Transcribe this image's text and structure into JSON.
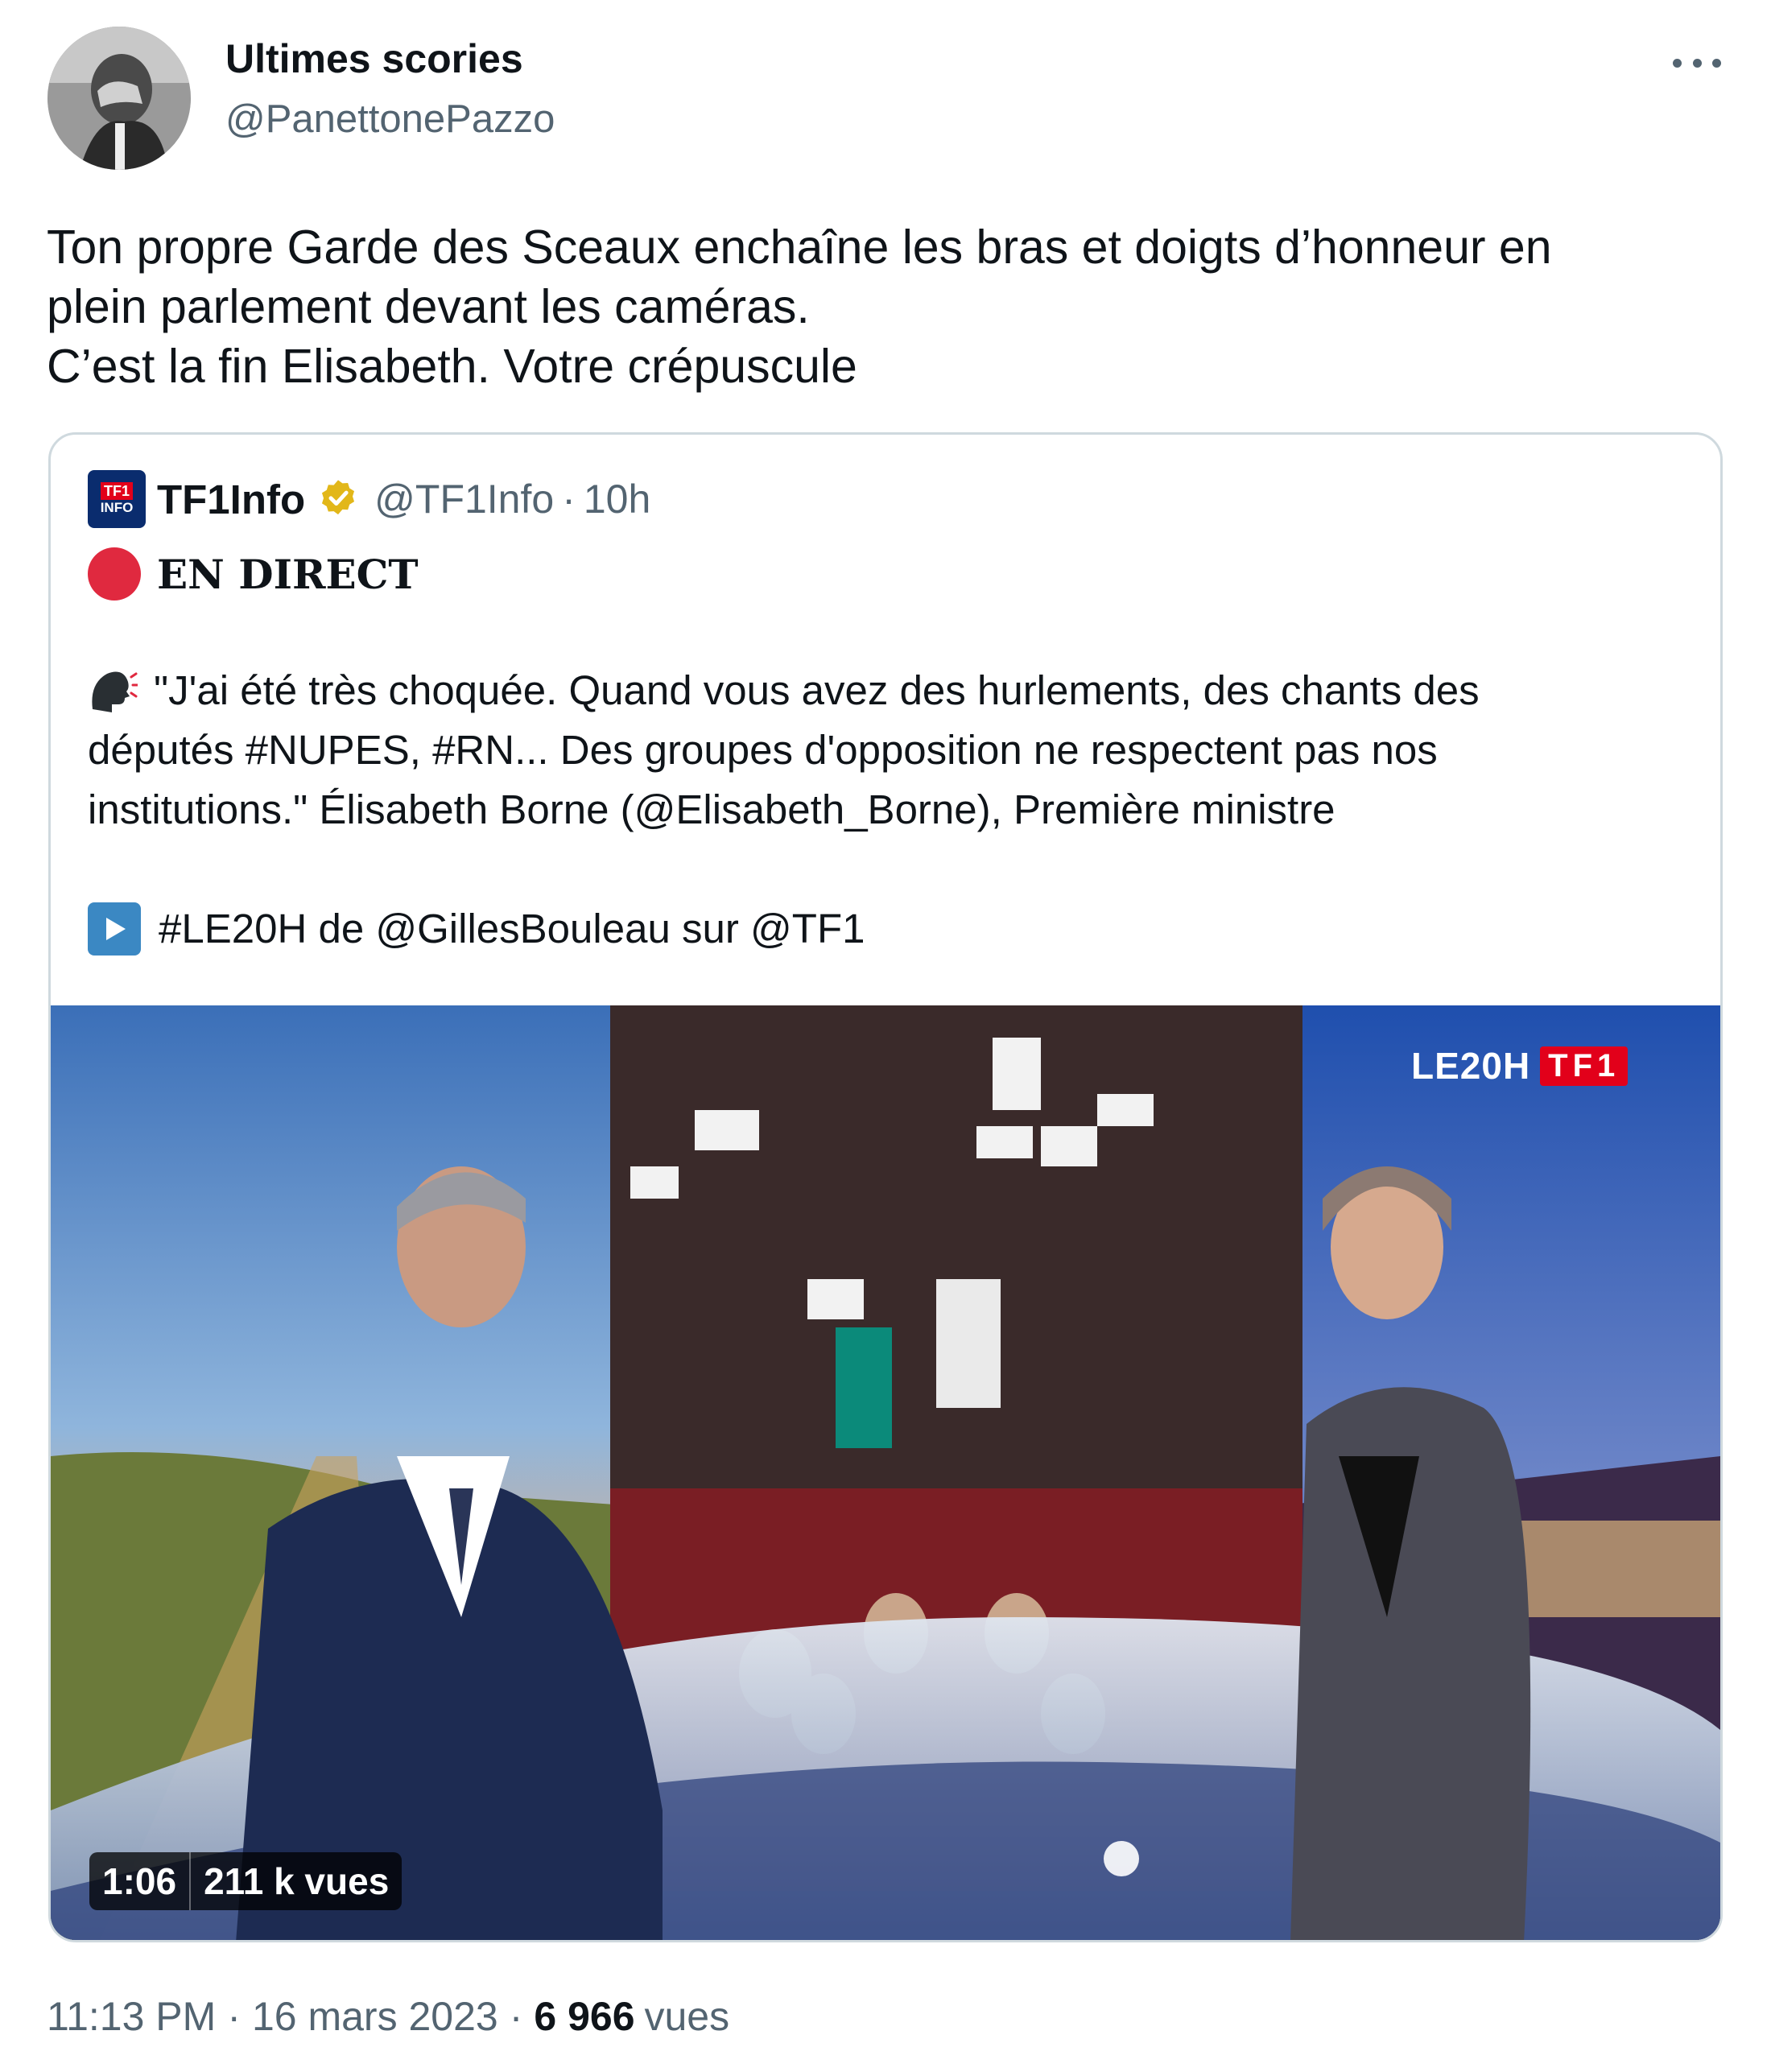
{
  "author": {
    "name": "Ultimes scories",
    "handle": "@PanettonePazzo",
    "avatar": "grayscale-man-facepalm-photo"
  },
  "more_icon": "more-horizontal-icon",
  "tweet_lines": [
    "Ton propre Garde des Sceaux enchaîne les bras et doigts d’honneur en",
    "plein parlement devant les caméras.",
    "C’est la fin Elisabeth. Votre crépuscule"
  ],
  "quote": {
    "logo_line1": "TF1",
    "logo_line2": "INFO",
    "name": "TF1Info",
    "verified_icon": "gold-verified-badge-icon",
    "handle": "@TF1Info",
    "separator": "·",
    "time": "10h",
    "live_label": "EN DIRECT",
    "body_lines": [
      "\"J'ai été très choquée. Quand vous avez des hurlements, des chants des",
      "députés #NUPES, #RN... Des groupes d'opposition ne respectent pas nos",
      "institutions.\" Élisabeth Borne (@Elisabeth_Borne), Première ministre"
    ],
    "link_line": "#LE20H de @GillesBouleau sur @TF1",
    "media": {
      "brand_le": "LE20H",
      "brand_tf1": "TF1",
      "duration": "1:06",
      "views": "211 k vues"
    }
  },
  "footer": {
    "time": "11:13 PM",
    "separator": "·",
    "date": "16 mars 2023",
    "views_count": "6 966",
    "views_label": "vues"
  },
  "colors": {
    "text": "#0f1419",
    "secondary": "#536471",
    "border": "#cfd9de",
    "live_red": "#e0293f",
    "tf1_red": "#e2001a"
  }
}
